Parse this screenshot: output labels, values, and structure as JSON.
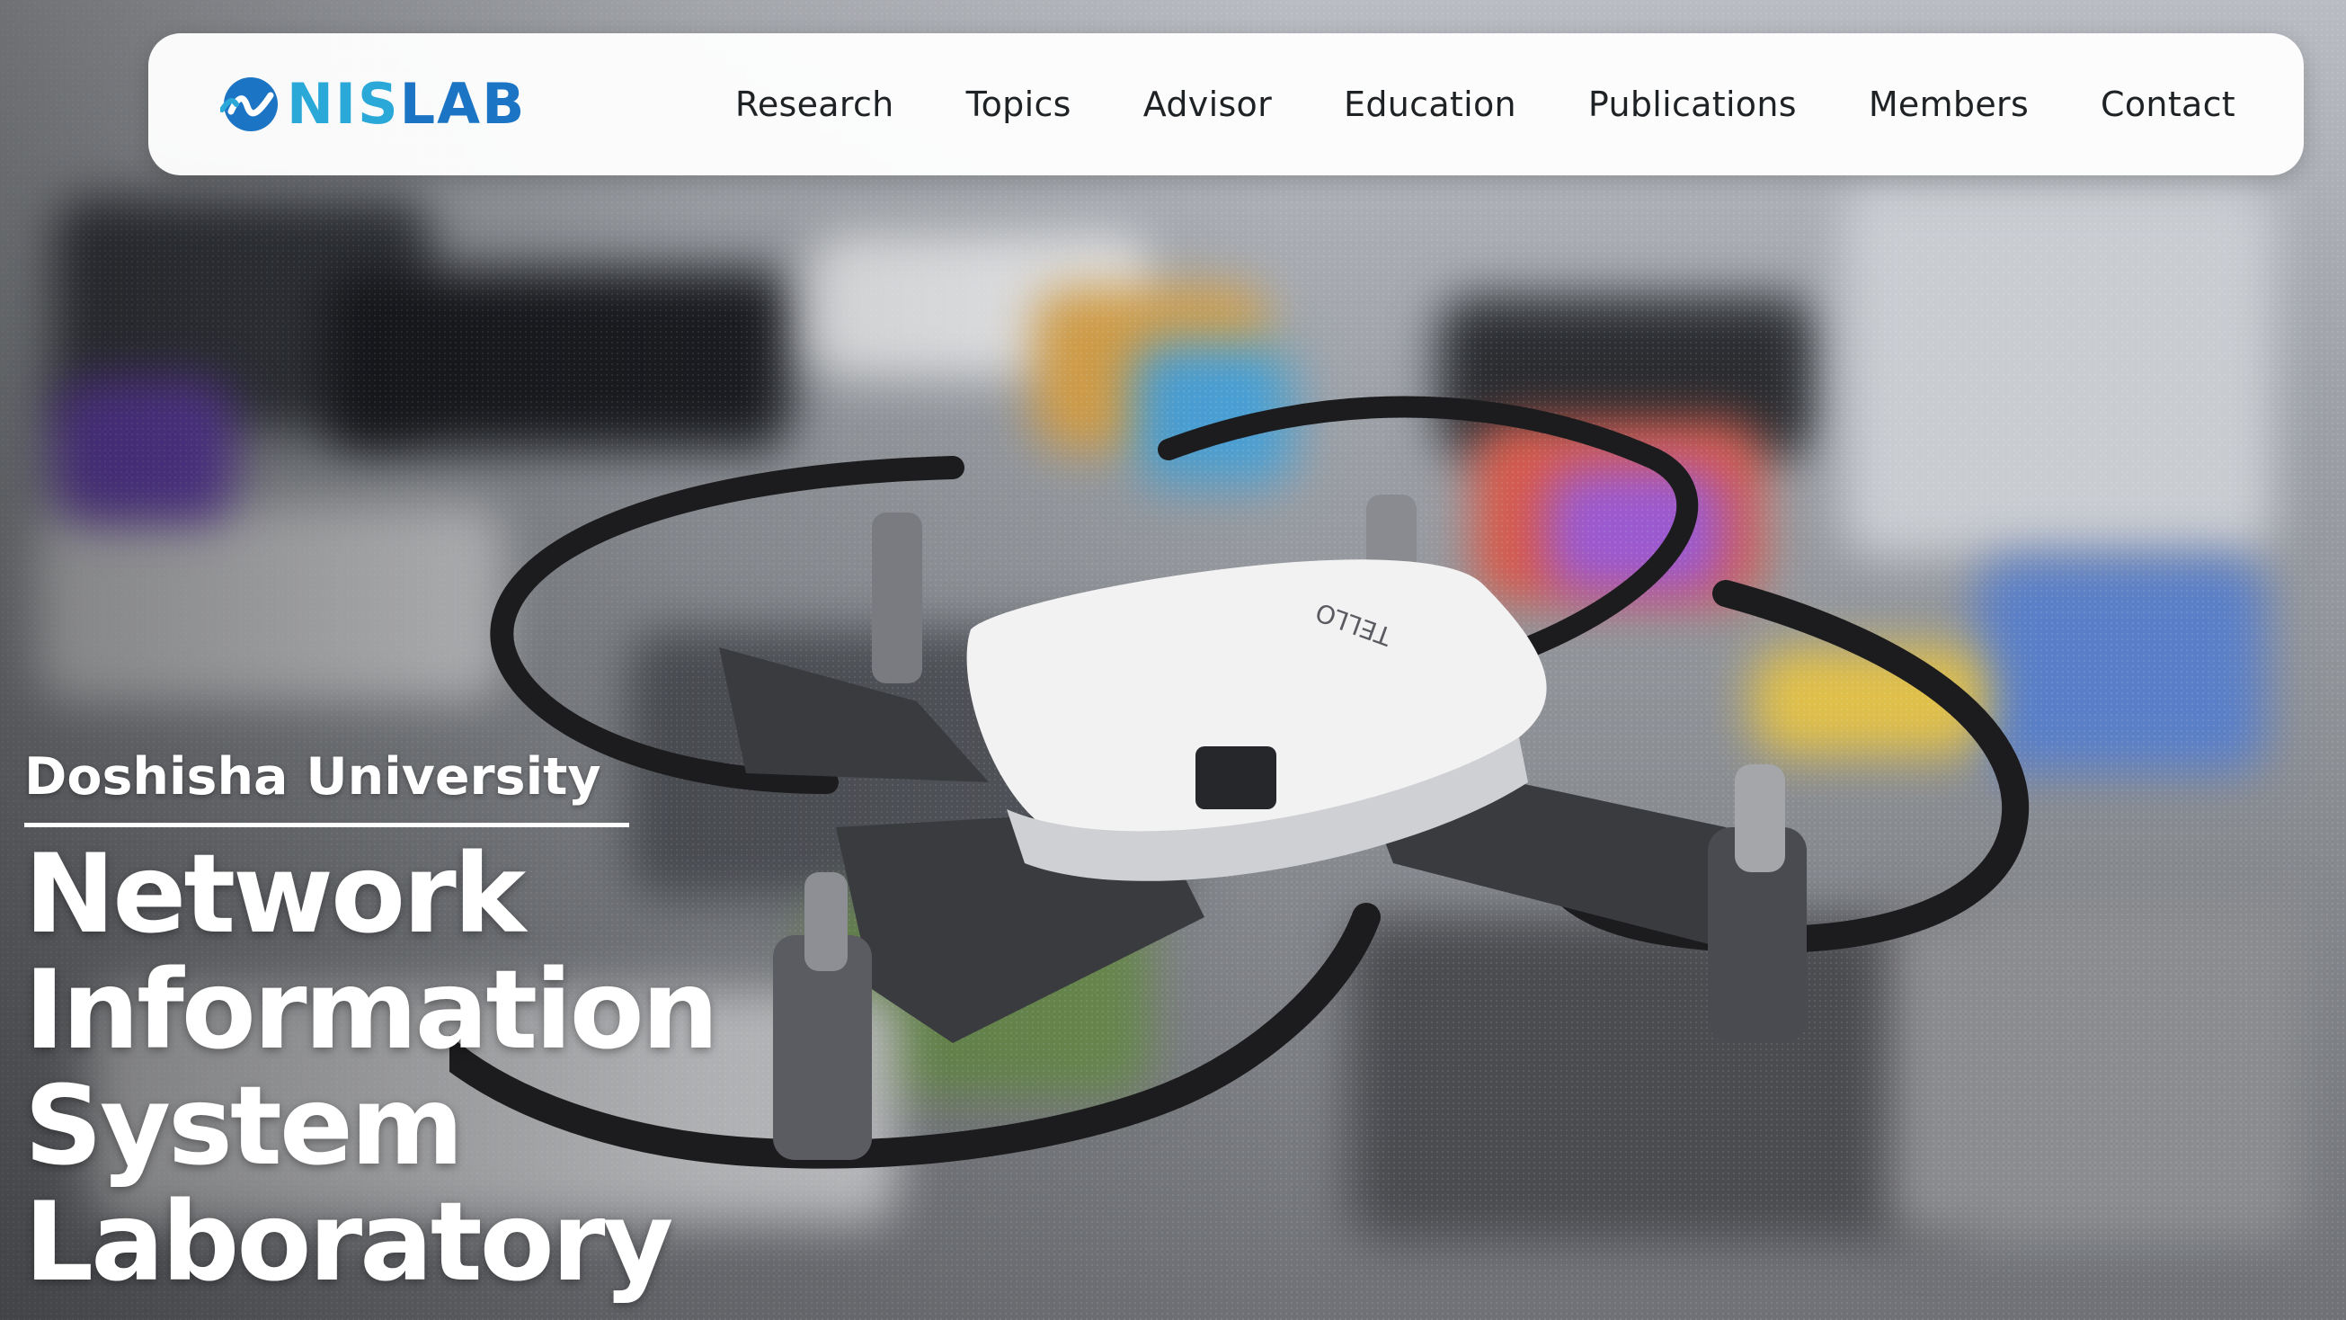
{
  "header": {
    "logo_text_part1": "NIS",
    "logo_text_part2": "LAB",
    "logo_icon": "nislab-wave-logo-icon",
    "nav_items": [
      {
        "label": "Research"
      },
      {
        "label": "Topics"
      },
      {
        "label": "Advisor"
      },
      {
        "label": "Education"
      },
      {
        "label": "Publications"
      },
      {
        "label": "Members"
      },
      {
        "label": "Contact"
      }
    ]
  },
  "hero": {
    "university": "Doshisha University",
    "lab_name_lines": [
      "Network",
      "Information",
      "System",
      "Laboratory"
    ],
    "drone_label": "TELLO",
    "background_image": "blurred-lab-with-drone-photo"
  },
  "colors": {
    "logo_light": "#2aa8d8",
    "logo_dark": "#1b74c4",
    "nav_text": "#1f2225",
    "hero_text": "#ffffff"
  }
}
